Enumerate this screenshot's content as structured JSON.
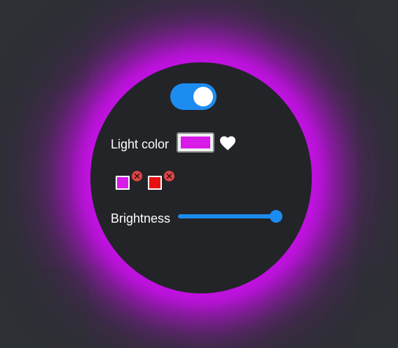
{
  "power": {
    "on": true
  },
  "light_color": {
    "label": "Light color",
    "value": "#d81be8",
    "favorite_icon": "heart-icon"
  },
  "saved_colors": [
    {
      "color": "#d81be8",
      "remove_icon": "close-icon"
    },
    {
      "color": "#e81010",
      "remove_icon": "close-icon"
    }
  ],
  "brightness": {
    "label": "Brightness",
    "value": 1.0
  },
  "colors": {
    "background": "#2d3035",
    "disc": "#222428",
    "glow": "#c012e0",
    "accent": "#1d8cf0",
    "remove": "#e04545"
  }
}
